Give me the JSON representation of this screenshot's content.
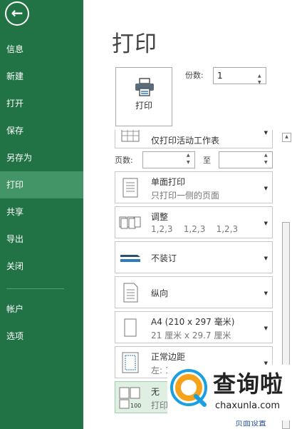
{
  "sidebar": {
    "back_label": "←",
    "items": [
      {
        "label": "信息"
      },
      {
        "label": "新建"
      },
      {
        "label": "打开"
      },
      {
        "label": "保存"
      },
      {
        "label": "另存为"
      },
      {
        "label": "打印",
        "active": true
      },
      {
        "label": "共享"
      },
      {
        "label": "导出"
      },
      {
        "label": "关闭"
      },
      {
        "label": "帐户"
      },
      {
        "label": "选项"
      }
    ]
  },
  "header": {
    "title": "打印",
    "top_fragment": "     "
  },
  "print_button": {
    "label": "打印"
  },
  "copies": {
    "label": "份数:",
    "value": "1"
  },
  "settings": {
    "print_what": {
      "line1": "仅打印活动工作表"
    },
    "pages": {
      "label": "页数:",
      "to": "至"
    },
    "sides": {
      "line1": "单面打印",
      "line2": "只打印一侧的页面"
    },
    "collate": {
      "line1": "调整",
      "line2": "1,2,3    1,2,3    1,2,3"
    },
    "staple": {
      "line1": "不装订"
    },
    "orientation": {
      "line1": "纵向"
    },
    "paper": {
      "line1": "A4 (210 x 297 毫米)",
      "line2": "21 厘米 x 29.7 厘米"
    },
    "margins": {
      "line1": "正常边距",
      "line2": "左: 1"
    },
    "scaling": {
      "line1": "无",
      "line2": "打印"
    }
  },
  "page_setup_link": "页面设置",
  "watermark": {
    "title": "查询啦",
    "subtitle": "chaxunla.com"
  },
  "colors": {
    "sidebar": "#217346",
    "active": "#439467",
    "accent_blue": "#2e5a9e"
  }
}
